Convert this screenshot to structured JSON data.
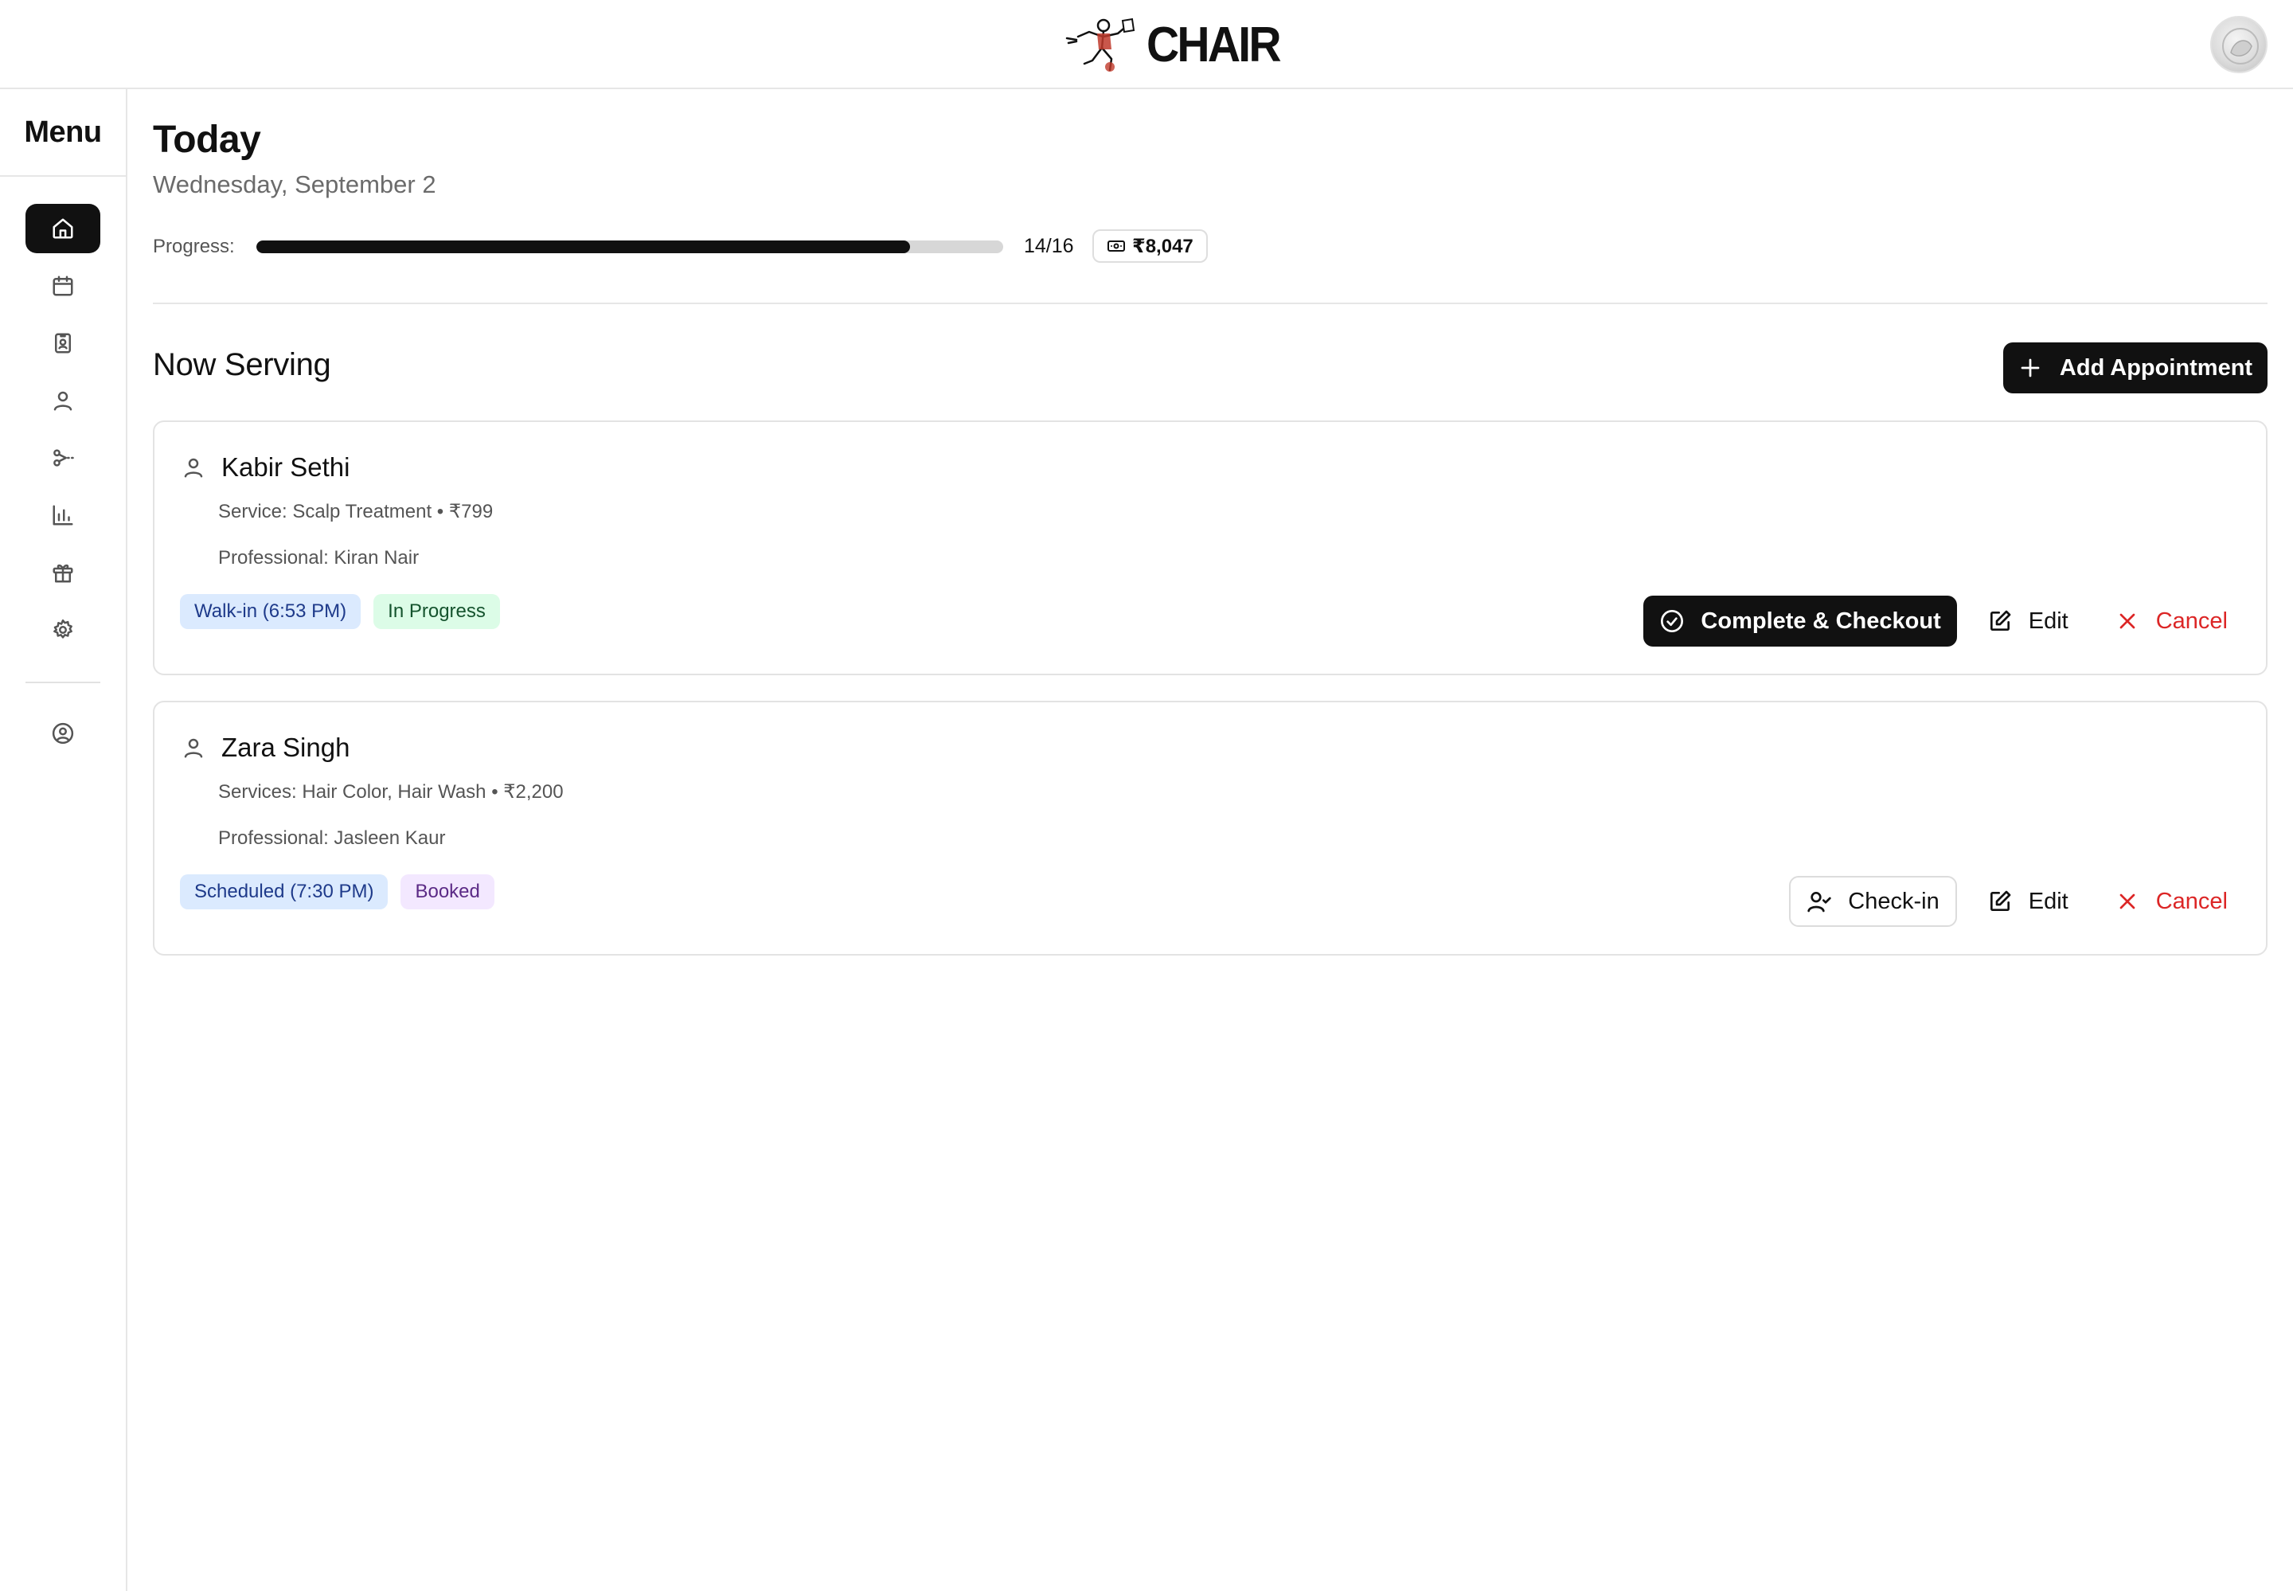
{
  "app": {
    "brand_name": "CHAIR",
    "logo_icon": "barber-running-logo",
    "avatar_icon": "user-avatar"
  },
  "sidebar": {
    "title": "Menu",
    "items": [
      {
        "icon": "home-icon",
        "active": true
      },
      {
        "icon": "calendar-icon",
        "active": false
      },
      {
        "icon": "id-badge-icon",
        "active": false
      },
      {
        "icon": "user-icon",
        "active": false
      },
      {
        "icon": "scissors-icon",
        "active": false
      },
      {
        "icon": "bar-chart-icon",
        "active": false
      },
      {
        "icon": "gift-icon",
        "active": false
      },
      {
        "icon": "settings-icon",
        "active": false
      }
    ],
    "footer_item": {
      "icon": "user-circle-icon"
    }
  },
  "header": {
    "title": "Today",
    "date": "Wednesday, September 2"
  },
  "progress": {
    "label": "Progress:",
    "completed": 14,
    "total": 16,
    "count_text": "14/16",
    "revenue_icon": "banknote-icon",
    "revenue": "₹8,047"
  },
  "now_serving": {
    "title": "Now Serving",
    "add_label": "Add Appointment",
    "add_icon": "plus-icon"
  },
  "appointments": [
    {
      "name": "Kabir Sethi",
      "service": "Service: Scalp Treatment • ₹799",
      "professional": "Professional: Kiran Nair",
      "tags": [
        {
          "label": "Walk-in (6:53 PM)",
          "color": "#dbeafe"
        },
        {
          "label": "In Progress",
          "color": "#dcfce7"
        }
      ],
      "primary_action": "Complete & Checkout",
      "edit_label": "Edit",
      "cancel_label": "Cancel"
    },
    {
      "name": "Zara Singh",
      "service": "Services: Hair Color, Hair Wash • ₹2,200",
      "professional": "Professional: Jasleen Kaur",
      "tags": [
        {
          "label": "Scheduled (7:30 PM)",
          "color": "#dbeafe"
        },
        {
          "label": "Booked",
          "color": "#f3e8ff"
        }
      ],
      "primary_action": "Check-in",
      "edit_label": "Edit",
      "cancel_label": "Cancel"
    }
  ],
  "colors": {
    "accent": "#111111",
    "danger": "#dc2626",
    "tag_blue_text": "#1e3a8a",
    "tag_green_text": "#14532d",
    "tag_purple_text": "#5b2a86"
  }
}
